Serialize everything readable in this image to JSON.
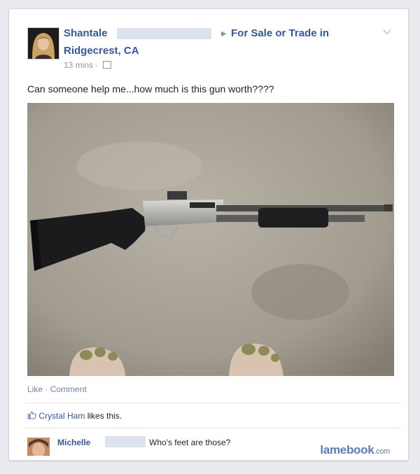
{
  "post": {
    "author_first_name": "Shantale",
    "arrow": "▶",
    "group_name": "For Sale or Trade in",
    "group_location": "Ridgecrest, CA",
    "timestamp": "13 mins",
    "meta_separator": "·",
    "body_text": "Can someone help me...how much is this gun worth????"
  },
  "actions": {
    "like_label": "Like",
    "separator": "·",
    "comment_label": "Comment"
  },
  "likes": {
    "liker_name": "Crystal Ham",
    "suffix": "likes this."
  },
  "comment": {
    "author_first_name": "Michelle",
    "text": "Who's feet are those?"
  },
  "watermark": {
    "brand": "lamebook",
    "domain": ".com"
  },
  "icons": {
    "chevron": "chevron-down-icon",
    "audience": "group-audience-icon",
    "like": "thumbs-up-icon"
  },
  "colors": {
    "link_blue": "#365899",
    "action_blue": "#6d84b4",
    "meta_gray": "#90949c",
    "watermark_blue": "#5a7fb6",
    "redaction": "#dde3ee"
  }
}
